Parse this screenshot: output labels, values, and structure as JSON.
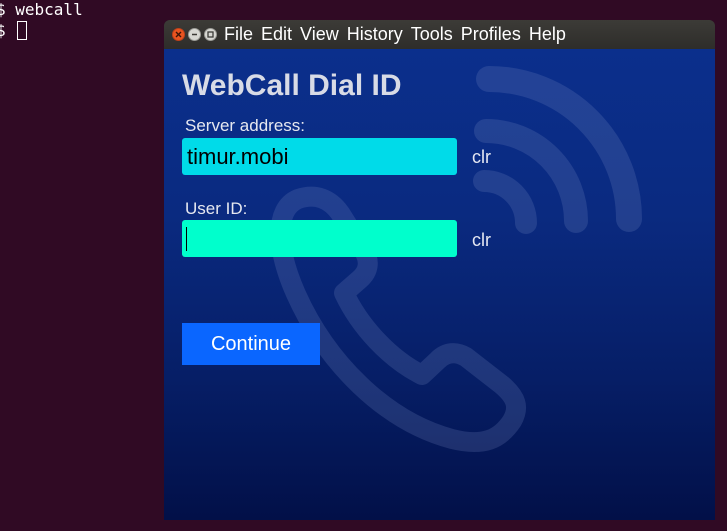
{
  "terminal": {
    "prompt": "$",
    "command": "webcall",
    "line1": "$ webcall",
    "line2_prompt": "$ "
  },
  "window": {
    "menu": [
      "File",
      "Edit",
      "View",
      "History",
      "Tools",
      "Profiles",
      "Help"
    ]
  },
  "app": {
    "title": "WebCall Dial ID",
    "server": {
      "label": "Server address:",
      "value": "timur.mobi",
      "clear_label": "clr"
    },
    "user": {
      "label": "User ID:",
      "value": "",
      "clear_label": "clr"
    },
    "continue_label": "Continue",
    "colors": {
      "server_field": "#00dbe9",
      "user_field": "#00ffcc",
      "button": "#0a66ff",
      "background_top": "#0b2f8c",
      "background_bottom": "#021048"
    }
  }
}
